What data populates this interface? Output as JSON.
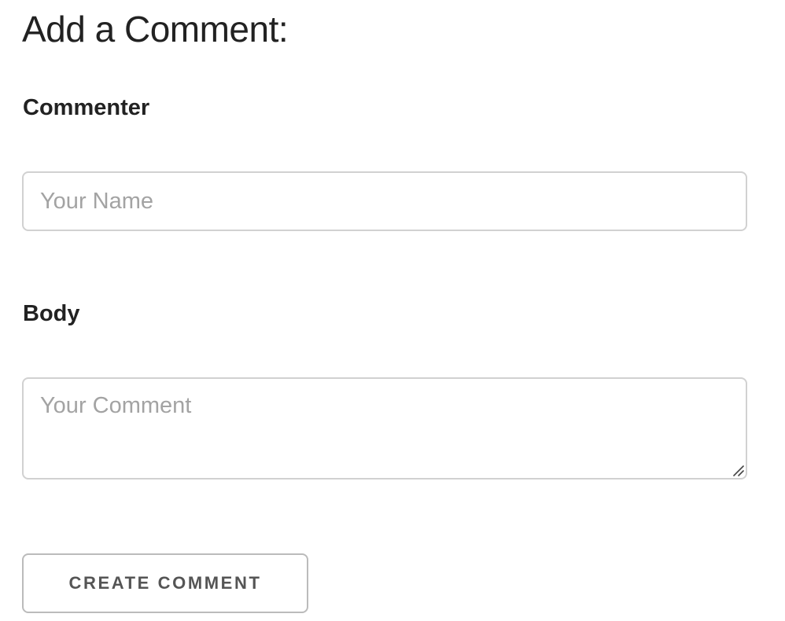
{
  "form": {
    "title": "Add a Comment:",
    "commenter": {
      "label": "Commenter",
      "placeholder": "Your Name",
      "value": ""
    },
    "body": {
      "label": "Body",
      "placeholder": "Your Comment",
      "value": ""
    },
    "submit_label": "CREATE COMMENT"
  },
  "icons": {
    "resize_handle": "resize-grip-icon"
  },
  "colors": {
    "text": "#222222",
    "placeholder": "#a3a3a3",
    "input_border": "#d1d1d1",
    "button_border": "#bbbbbb",
    "button_text": "#555555"
  }
}
